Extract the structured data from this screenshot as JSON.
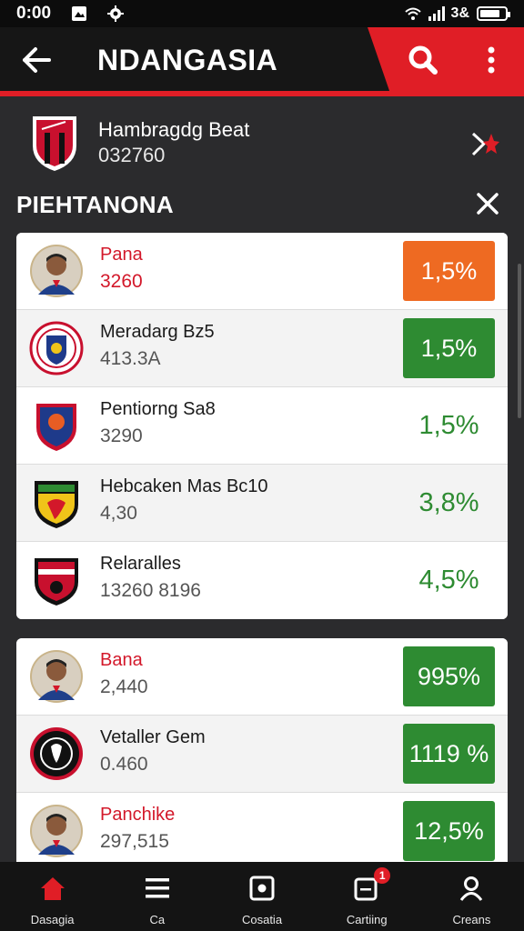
{
  "status_bar": {
    "time": "0:00",
    "battery_text": "3&",
    "battery_level": 0.8
  },
  "app_bar": {
    "title": "NDANGASIA"
  },
  "team": {
    "name": "Hambragdg Beat",
    "code": "032760"
  },
  "section": {
    "title": "PIEHTANONA"
  },
  "list_primary": [
    {
      "name": "Pana",
      "value": "3260",
      "percent": "1,5%",
      "style": "orange",
      "name_color": "red",
      "value_color": "red",
      "avatar": "player-photo"
    },
    {
      "name": "Meradarg Bz5",
      "value": "413.3A",
      "percent": "1,5%",
      "style": "green",
      "name_color": "dark",
      "value_color": "gray",
      "avatar": "club-badge-round"
    },
    {
      "name": "Pentiorng Sa8",
      "value": "3290",
      "percent": "1,5%",
      "style": "plain",
      "name_color": "dark",
      "value_color": "gray",
      "avatar": "club-shield-blue"
    },
    {
      "name": "Hebcaken Mas Bc10",
      "value": "4,30",
      "percent": "3,8%",
      "style": "plain",
      "name_color": "dark",
      "value_color": "gray",
      "avatar": "club-shield-yellow"
    },
    {
      "name": "Relaralles",
      "value": "13260 8196",
      "percent": "4,5%",
      "style": "plain",
      "name_color": "dark",
      "value_color": "gray",
      "avatar": "club-shield-red"
    }
  ],
  "list_secondary": [
    {
      "name": "Bana",
      "value": "2,440",
      "percent": "995%",
      "style": "green",
      "name_color": "red",
      "value_color": "gray",
      "avatar": "player-photo"
    },
    {
      "name": "Vetaller Gem",
      "value": "0.460",
      "percent": "1119 %",
      "style": "green",
      "name_color": "dark",
      "value_color": "gray",
      "avatar": "club-badge-dark"
    },
    {
      "name": "Panchike",
      "value": "297,515",
      "percent": "12,5%",
      "style": "green",
      "name_color": "red",
      "value_color": "gray",
      "avatar": "player-photo"
    }
  ],
  "bottom_nav": [
    {
      "label": "Dasagia",
      "icon": "home-icon",
      "active": true
    },
    {
      "label": "Ca",
      "icon": "menu-icon",
      "active": false
    },
    {
      "label": "Cosatia",
      "icon": "record-icon",
      "active": false
    },
    {
      "label": "Cartiing",
      "icon": "notes-icon",
      "active": false,
      "badge": "1"
    },
    {
      "label": "Creans",
      "icon": "profile-icon",
      "active": false
    }
  ],
  "colors": {
    "accent": "#e01e26",
    "green": "#2e8b32",
    "orange": "#ee6a22"
  }
}
